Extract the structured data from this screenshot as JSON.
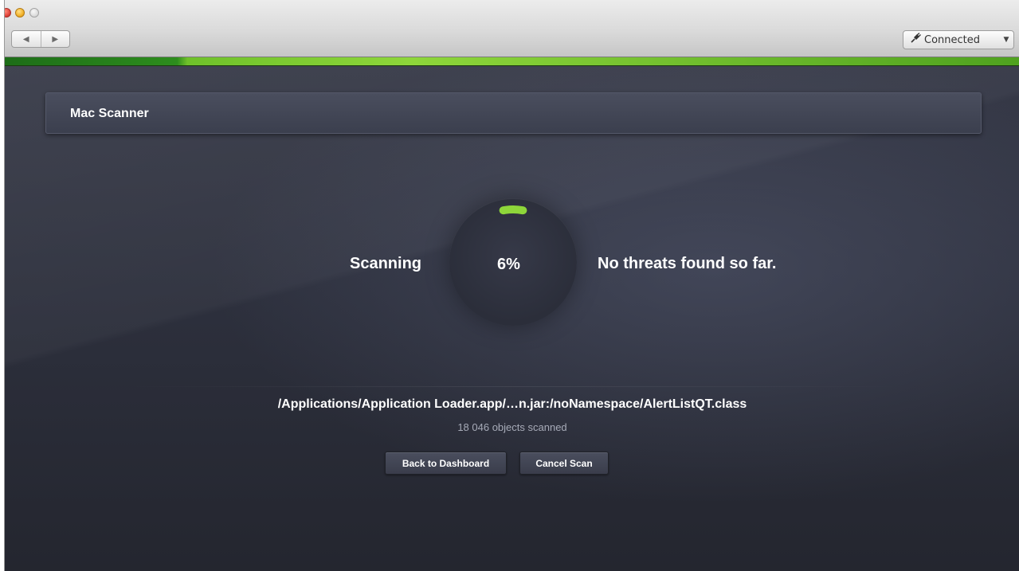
{
  "window": {
    "controls": [
      "close",
      "minimize",
      "zoom"
    ]
  },
  "toolbar": {
    "back_icon": "◀",
    "forward_icon": "▶",
    "connection_icon": "plug-icon",
    "connection_label": "Connected",
    "connection_arrow": "▼"
  },
  "panel": {
    "title": "Mac Scanner"
  },
  "scan": {
    "status_label": "Scanning",
    "progress_text": "6%",
    "progress_value": 6,
    "result_label": "No threats found so far.",
    "current_file": "/Applications/Application Loader.app/…n.jar:/noNamespace/AlertListQT.class",
    "objects_scanned": "18 046 objects scanned"
  },
  "actions": {
    "back_label": "Back to Dashboard",
    "cancel_label": "Cancel Scan"
  },
  "colors": {
    "accent_green": "#8ed63a",
    "background": "#2d303d"
  }
}
